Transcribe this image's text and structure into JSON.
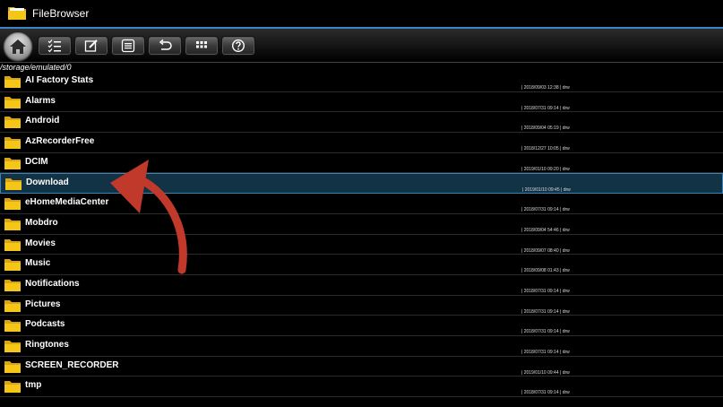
{
  "app": {
    "title": "FileBrowser"
  },
  "toolbar": {
    "buttons": [
      {
        "icon": "checklist-icon"
      },
      {
        "icon": "edit-icon"
      },
      {
        "icon": "list-icon"
      },
      {
        "icon": "undo-icon"
      },
      {
        "icon": "grid-icon"
      },
      {
        "icon": "help-icon"
      }
    ]
  },
  "path": "/storage/emulated/0",
  "files": [
    {
      "name": "AI Factory Stats",
      "meta": "| 2018/09/03 12:38 | drw"
    },
    {
      "name": "Alarms",
      "meta": "| 2018/07/31 09:14 | drw"
    },
    {
      "name": "Android",
      "meta": "| 2018/09/04 05:19 | drw"
    },
    {
      "name": "AzRecorderFree",
      "meta": "| 2018/12/27 10:05 | drw"
    },
    {
      "name": "DCIM",
      "meta": "| 2019/01/10 09:20 | drw"
    },
    {
      "name": "Download",
      "meta": "| 2019/01/10 09:45 | drw"
    },
    {
      "name": "eHomeMediaCenter",
      "meta": "| 2018/07/31 09:14 | drw"
    },
    {
      "name": "Mobdro",
      "meta": "| 2018/09/04 54:46 | drw"
    },
    {
      "name": "Movies",
      "meta": "| 2018/09/07 08:40 | drw"
    },
    {
      "name": "Music",
      "meta": "| 2018/09/08 01:43 | drw"
    },
    {
      "name": "Notifications",
      "meta": "| 2018/07/31 09:14 | drw"
    },
    {
      "name": "Pictures",
      "meta": "| 2018/07/31 09:14 | drw"
    },
    {
      "name": "Podcasts",
      "meta": "| 2018/07/31 09:14 | drw"
    },
    {
      "name": "Ringtones",
      "meta": "| 2018/07/31 09:14 | drw"
    },
    {
      "name": "SCREEN_RECORDER",
      "meta": "| 2019/01/10 09:44 | drw"
    },
    {
      "name": "tmp",
      "meta": "| 2018/07/31 09:14 | drw"
    }
  ],
  "selected_index": 5,
  "colors": {
    "accent": "#3a86c8",
    "folder": "#f5c518",
    "arrow": "#c0392b"
  }
}
